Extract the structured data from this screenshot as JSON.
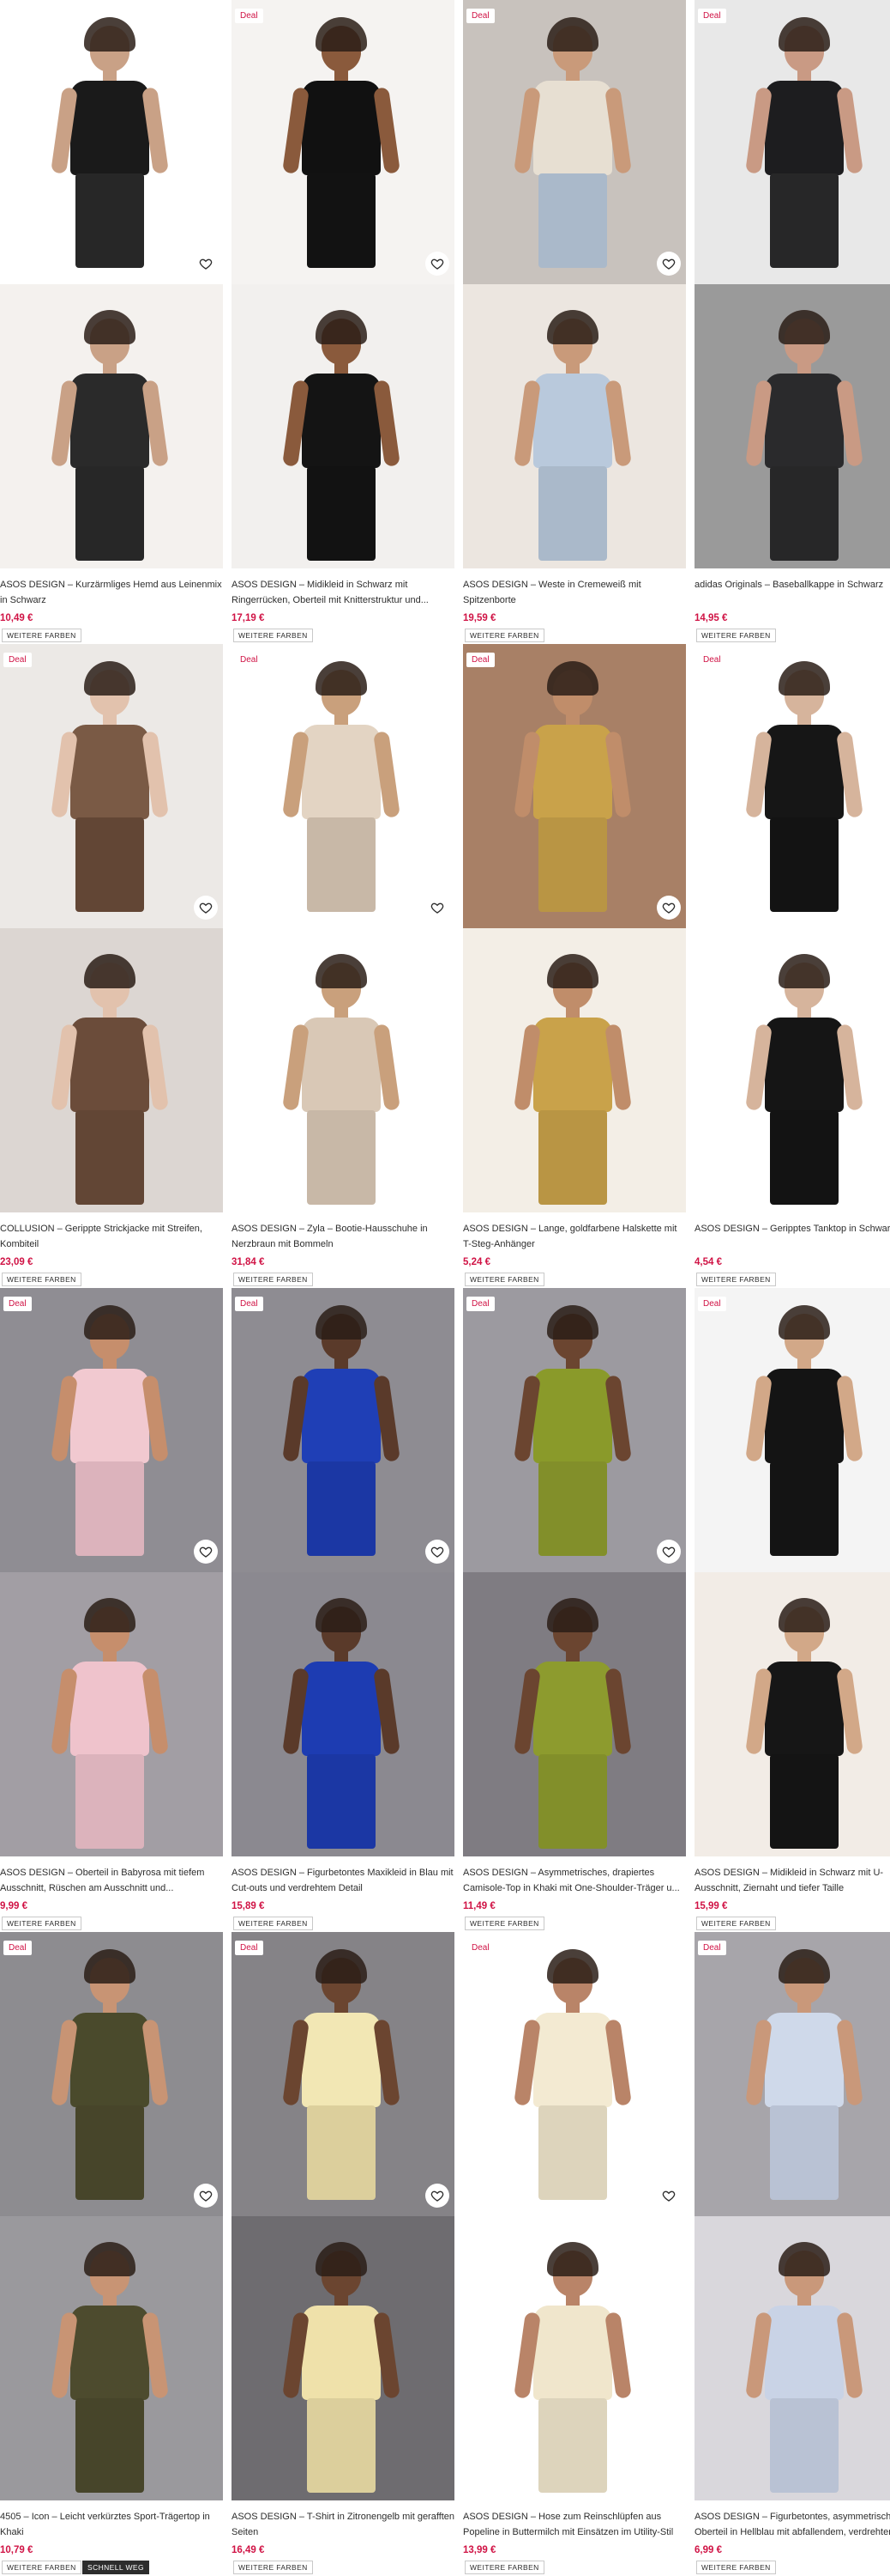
{
  "deal_label": "Deal",
  "more_colors_label": "WEITERE FARBEN",
  "quick_view_label": "SCHNELL WEG",
  "products": [
    {
      "title": "ASOS DESIGN – Kurzärmliges Hemd aus Leinenmix in Schwarz",
      "price": "10,49 €"
    },
    {
      "title": "ASOS DESIGN – Midikleid in Schwarz mit Ringerrücken, Oberteil mit Knitterstruktur und...",
      "price": "17,19 €"
    },
    {
      "title": "ASOS DESIGN – Weste in Cremeweiß mit Spitzenborte",
      "price": "19,59 €"
    },
    {
      "title": "adidas Originals – Baseballkappe in Schwarz",
      "price": "14,95 €"
    },
    {
      "title": "COLLUSION – Gerippte Strickjacke mit Streifen, Kombiteil",
      "price": "23,09 €"
    },
    {
      "title": "ASOS DESIGN – Zyla – Bootie-Hausschuhe in Nerzbraun mit Bommeln",
      "price": "31,84 €"
    },
    {
      "title": "ASOS DESIGN – Lange, goldfarbene Halskette mit T-Steg-Anhänger",
      "price": "5,24 €"
    },
    {
      "title": "ASOS DESIGN – Geripptes Tanktop in Schwarz",
      "price": "4,54 €"
    },
    {
      "title": "ASOS DESIGN – Oberteil in Babyrosa mit tiefem Ausschnitt, Rüschen am Ausschnitt und...",
      "price": "9,99 €"
    },
    {
      "title": "ASOS DESIGN – Figurbetontes Maxikleid in Blau mit Cut-outs und verdrehtem Detail",
      "price": "15,89 €"
    },
    {
      "title": "ASOS DESIGN – Asymmetrisches, drapiertes Camisole-Top in Khaki mit One-Shoulder-Träger u...",
      "price": "11,49 €"
    },
    {
      "title": "ASOS DESIGN – Midikleid in Schwarz mit U-Ausschnitt, Ziernaht und tiefer Taille",
      "price": "15,99 €"
    },
    {
      "title": "4505 – Icon – Leicht verkürztes Sport-Trägertop in Khaki",
      "price": "10,79 €"
    },
    {
      "title": "ASOS DESIGN – T-Shirt in Zitronengelb mit gerafften Seiten",
      "price": "16,49 €"
    },
    {
      "title": "ASOS DESIGN – Hose zum Reinschlüpfen aus Popeline in Buttermilch mit Einsätzen im Utility-Stil",
      "price": "13,99 €"
    },
    {
      "title": "ASOS DESIGN – Figurbetontes, asymmetrisches Oberteil in Hellblau mit abfallendem, verdrehtem",
      "price": "6,99 €"
    }
  ],
  "colors": {
    "price": "#d01345",
    "text": "#2d2d2d"
  }
}
